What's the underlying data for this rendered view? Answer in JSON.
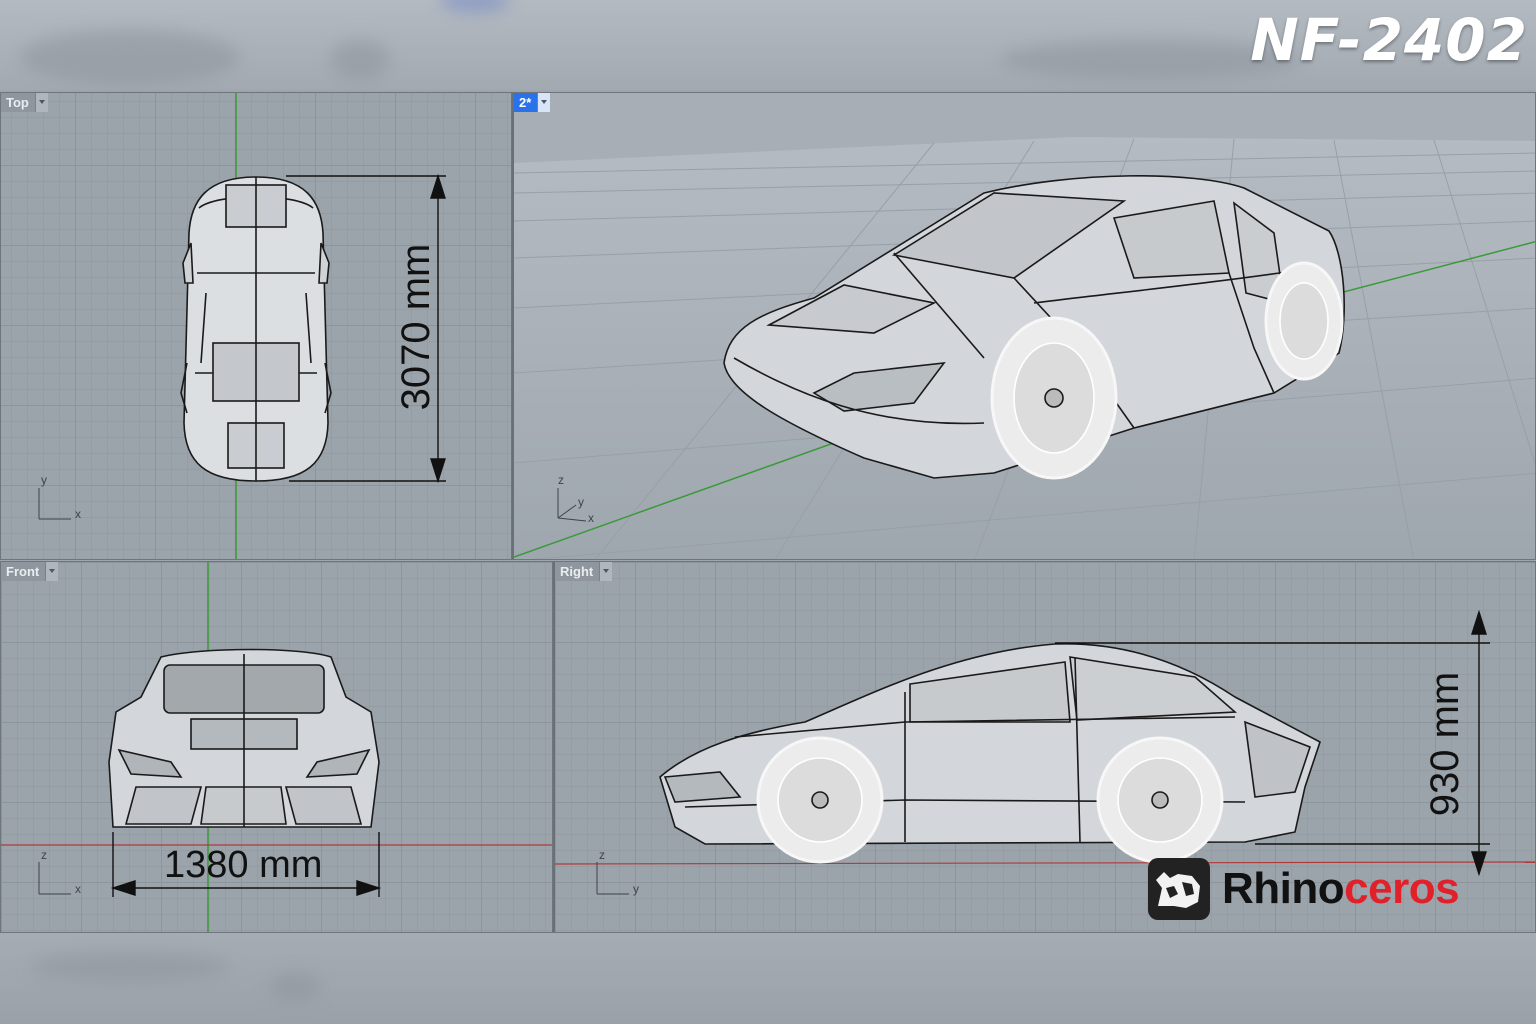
{
  "product_code": "NF-2402",
  "viewports": [
    {
      "id": "top",
      "name": "Top",
      "active": false,
      "dimension_label": "3070 mm",
      "axes": {
        "vertical": "y",
        "horizontal": "x"
      }
    },
    {
      "id": "perspective",
      "name": "2*",
      "active": true,
      "axes": {
        "vertical": "z",
        "horizontal": "x",
        "depth": "y"
      }
    },
    {
      "id": "front",
      "name": "Front",
      "active": false,
      "dimension_label": "1380 mm",
      "axes": {
        "vertical": "z",
        "horizontal": "x"
      }
    },
    {
      "id": "right",
      "name": "Right",
      "active": false,
      "dimension_label": "930 mm",
      "axes": {
        "vertical": "z",
        "horizontal": "y"
      }
    }
  ],
  "logo": {
    "word_dark": "Rhino",
    "word_red": "ceros",
    "icon": "rhino-head-icon"
  },
  "colors": {
    "active_tab": "#2a72e8",
    "x_axis": "#b03a3a",
    "y_axis": "#3a9a3a",
    "logo_red": "#e2202a",
    "viewport_bg": "#9ba3ab"
  }
}
